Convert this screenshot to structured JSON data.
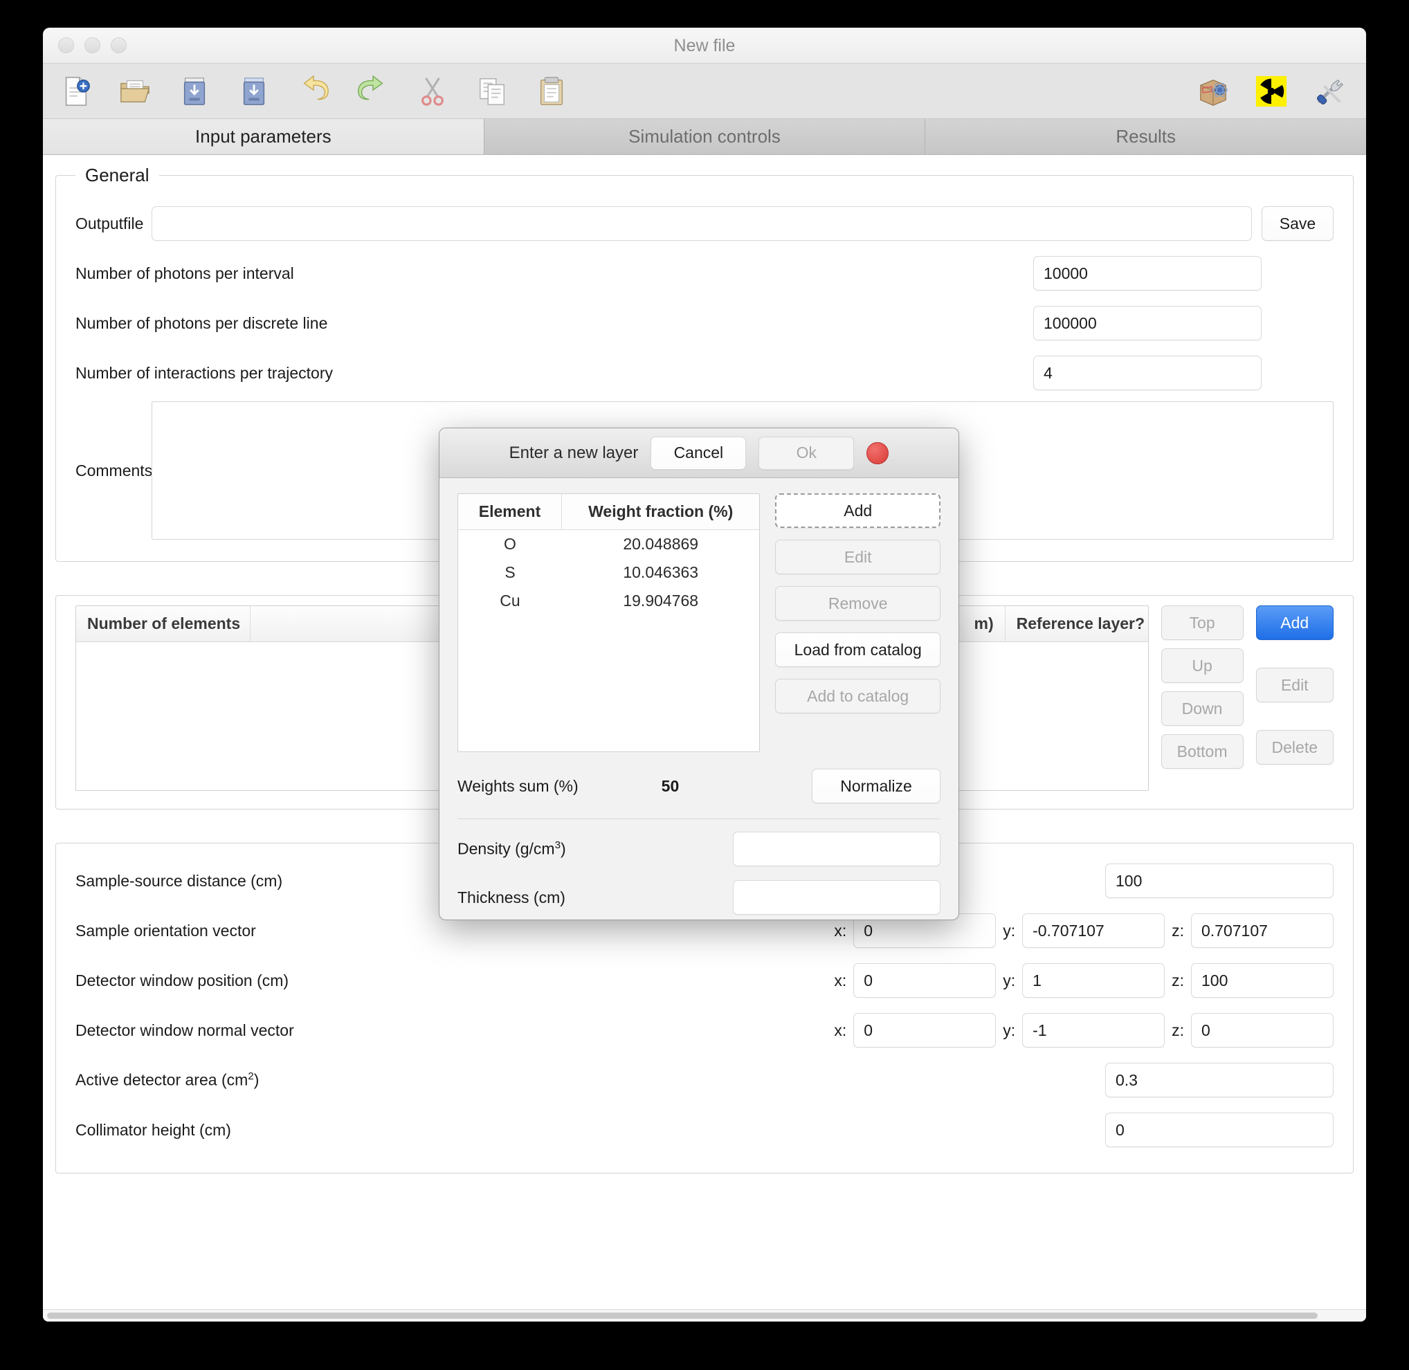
{
  "window": {
    "title": "New file",
    "traffic_lights": [
      "close",
      "minimize",
      "zoom"
    ]
  },
  "toolbar": {
    "left_icons": [
      {
        "name": "new-file-icon",
        "label": "New file"
      },
      {
        "name": "open-folder-icon",
        "label": "Open"
      },
      {
        "name": "save-icon",
        "label": "Save"
      },
      {
        "name": "save-as-icon",
        "label": "Save as"
      },
      {
        "name": "undo-icon",
        "label": "Undo"
      },
      {
        "name": "redo-icon",
        "label": "Redo"
      },
      {
        "name": "cut-icon",
        "label": "Cut"
      },
      {
        "name": "copy-icon",
        "label": "Copy"
      },
      {
        "name": "paste-icon",
        "label": "Paste"
      }
    ],
    "right_icons": [
      {
        "name": "package-atom-icon",
        "label": "Material catalog"
      },
      {
        "name": "radiation-icon",
        "label": "Radiation"
      },
      {
        "name": "tools-icon",
        "label": "Tools"
      }
    ]
  },
  "tabs": [
    {
      "label": "Input parameters",
      "active": true
    },
    {
      "label": "Simulation controls",
      "active": false
    },
    {
      "label": "Results",
      "active": false
    }
  ],
  "general": {
    "legend": "General",
    "outputfile_label": "Outputfile",
    "outputfile_value": "",
    "save_label": "Save",
    "photons_interval_label": "Number of photons per interval",
    "photons_interval_value": "10000",
    "photons_line_label": "Number of photons per discrete line",
    "photons_line_value": "100000",
    "interactions_label": "Number of interactions per trajectory",
    "interactions_value": "4",
    "comments_label": "Comments",
    "comments_value": ""
  },
  "layers": {
    "columns": [
      "Number of elements",
      "m)",
      "Reference layer?"
    ],
    "rows": [],
    "order_buttons": [
      {
        "label": "Top",
        "enabled": false
      },
      {
        "label": "Up",
        "enabled": false
      },
      {
        "label": "Down",
        "enabled": false
      },
      {
        "label": "Bottom",
        "enabled": false
      }
    ],
    "edit_buttons": [
      {
        "label": "Add",
        "enabled": true,
        "style": "primary"
      },
      {
        "label": "Edit",
        "enabled": false,
        "style": "default"
      },
      {
        "label": "Delete",
        "enabled": false,
        "style": "default"
      }
    ]
  },
  "geometry": {
    "sample_source_distance_label": "Sample-source distance (cm)",
    "sample_source_distance_value": "100",
    "sample_orientation_label": "Sample orientation vector",
    "sample_orientation": {
      "x": "0",
      "y": "-0.707107",
      "z": "0.707107"
    },
    "detector_position_label": "Detector window position (cm)",
    "detector_position": {
      "x": "0",
      "y": "1",
      "z": "100"
    },
    "detector_normal_label": "Detector window normal vector",
    "detector_normal": {
      "x": "0",
      "y": "-1",
      "z": "0"
    },
    "active_area_label_pre": "Active detector area (cm",
    "active_area_sup": "2",
    "active_area_label_post": ")",
    "active_area_value": "0.3",
    "collimator_label": "Collimator height (cm)",
    "collimator_value": "0",
    "axis_x": "x:",
    "axis_y": "y:",
    "axis_z": "z:"
  },
  "modal": {
    "title": "Enter a new layer",
    "cancel_label": "Cancel",
    "ok_label": "Ok",
    "ok_enabled": false,
    "table": {
      "headers": [
        "Element",
        "Weight fraction (%)"
      ],
      "rows": [
        {
          "element": "O",
          "weight": "20.048869"
        },
        {
          "element": "S",
          "weight": "10.046363"
        },
        {
          "element": "Cu",
          "weight": "19.904768"
        }
      ]
    },
    "buttons": [
      {
        "label": "Add",
        "enabled": true,
        "focused": true
      },
      {
        "label": "Edit",
        "enabled": false,
        "focused": false
      },
      {
        "label": "Remove",
        "enabled": false,
        "focused": false
      },
      {
        "label": "Load from catalog",
        "enabled": true,
        "focused": false
      },
      {
        "label": "Add to catalog",
        "enabled": false,
        "focused": false
      }
    ],
    "weights_sum_label": "Weights sum (%)",
    "weights_sum_value": "50",
    "normalize_label": "Normalize",
    "density_label_pre": "Density (g/cm",
    "density_label_sup": "3",
    "density_label_post": ")",
    "density_value": "",
    "thickness_label": "Thickness (cm)",
    "thickness_value": ""
  },
  "colors": {
    "accent_blue": "#2f7ceb",
    "radiation_yellow": "#fdf000",
    "red_dot": "#d83b37"
  }
}
